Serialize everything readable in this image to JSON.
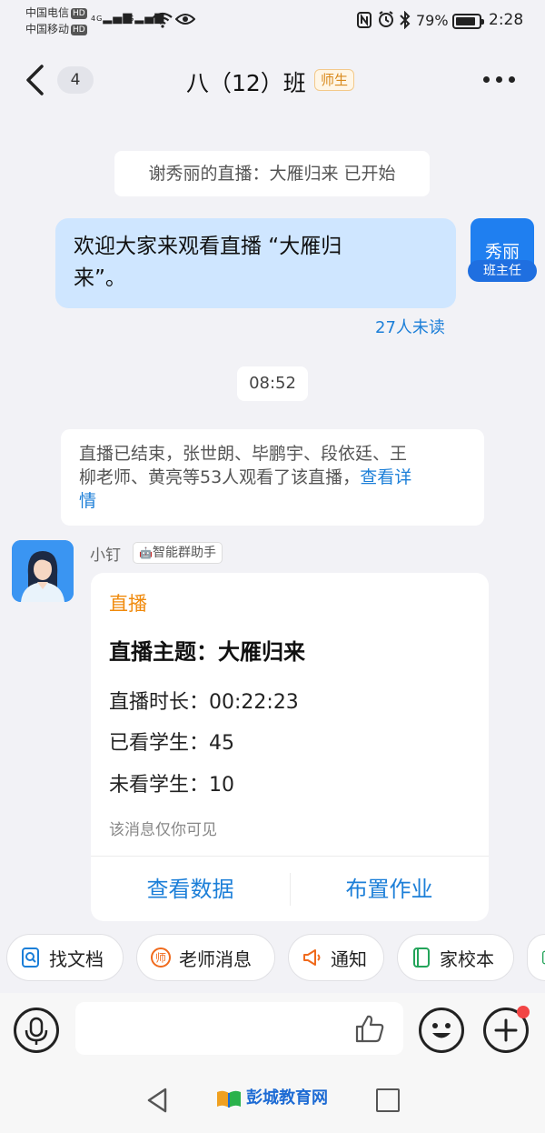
{
  "status_bar": {
    "carrier1": "中国电信",
    "carrier2": "中国移动",
    "hd": "HD",
    "signal1": "4G",
    "signal2": "4G",
    "battery": "79%",
    "time": "2:28"
  },
  "header": {
    "unread_count": "4",
    "title": "八（12）班",
    "role_tag": "师生"
  },
  "messages": {
    "system_notice": "谢秀丽的直播：大雁归来 已开始",
    "bubble_line1": "欢迎大家来观看直播 “大雁归",
    "bubble_line2": "来”。",
    "sender_name": "秀丽",
    "sender_role": "班主任",
    "unread_status": "27人未读",
    "time_chip": "08:52",
    "summary_line1": "直播已结束，张世朗、毕鹏宇、段依廷、王",
    "summary_line2": "柳老师、黄亮等53人观看了该直播，",
    "summary_link_a": "查看详",
    "summary_link_b": "情"
  },
  "bot": {
    "name": "小钉",
    "tag": "智能群助手",
    "card": {
      "type": "直播",
      "topic": "直播主题：大雁归来",
      "duration": "直播时长：00:22:23",
      "watched": "已看学生：45",
      "not_watched": "未看学生：10",
      "note": "该消息仅你可见",
      "btn_data": "查看数据",
      "btn_homework": "布置作业"
    }
  },
  "quick_actions": [
    "找文档",
    "老师消息",
    "通知",
    "家校本"
  ],
  "watermark": "彭城教育网",
  "colors": {
    "accent": "#1c7fd8",
    "bubble": "#cfe6ff",
    "card_type": "#f08a0c",
    "tag": "#d98a1c",
    "notify_dot": "#f24545"
  }
}
